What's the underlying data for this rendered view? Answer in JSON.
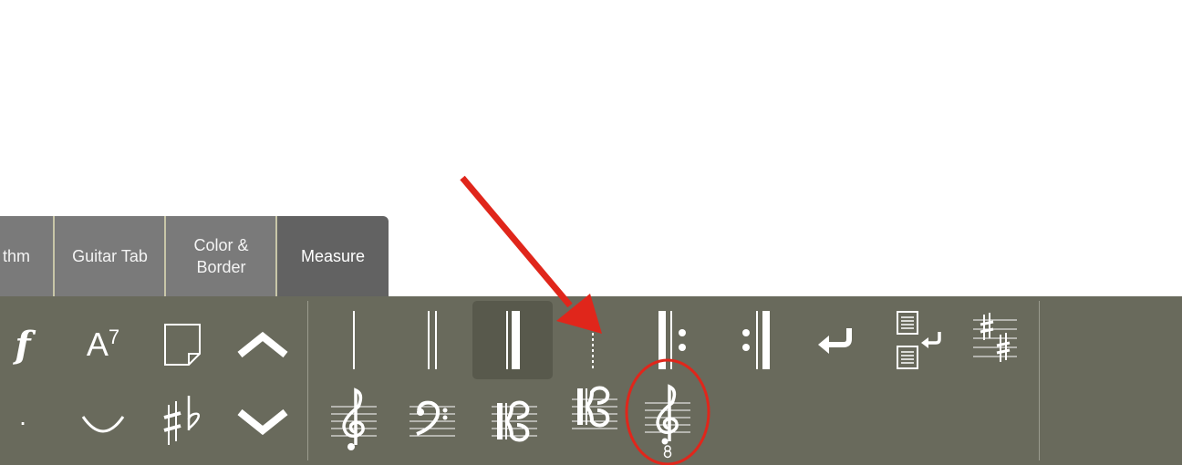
{
  "tabs": [
    {
      "label": "thm"
    },
    {
      "label": "Guitar Tab"
    },
    {
      "label": "Color & Border"
    },
    {
      "label": "Measure"
    }
  ],
  "palette": {
    "dynamic_glyph": "f",
    "chord_label": "A",
    "chord_superscript": "7",
    "staccato_glyph": "·"
  },
  "colors": {
    "toolbar_bg": "#696a5c",
    "tab_bg": "#7a7a7a",
    "active_tab_bg": "#626262",
    "annotation_red": "#e0261b"
  },
  "icons": {
    "row1_left": [
      "dynamics-icon",
      "chord-symbol-icon",
      "text-note-icon",
      "move-up-icon"
    ],
    "row2_left": [
      "staccato-icon",
      "slur-icon",
      "accidentals-icon",
      "move-down-icon"
    ],
    "row1_measure": [
      "single-barline-icon",
      "double-barline-icon",
      "final-barline-icon",
      "dotted-barline-icon",
      "repeat-start-icon",
      "repeat-end-icon",
      "line-break-icon",
      "page-break-icon",
      "key-signature-icon"
    ],
    "row2_measure": [
      "treble-clef-icon",
      "bass-clef-icon",
      "alto-clef-icon",
      "tenor-clef-icon",
      "treble-8vb-clef-icon"
    ]
  }
}
